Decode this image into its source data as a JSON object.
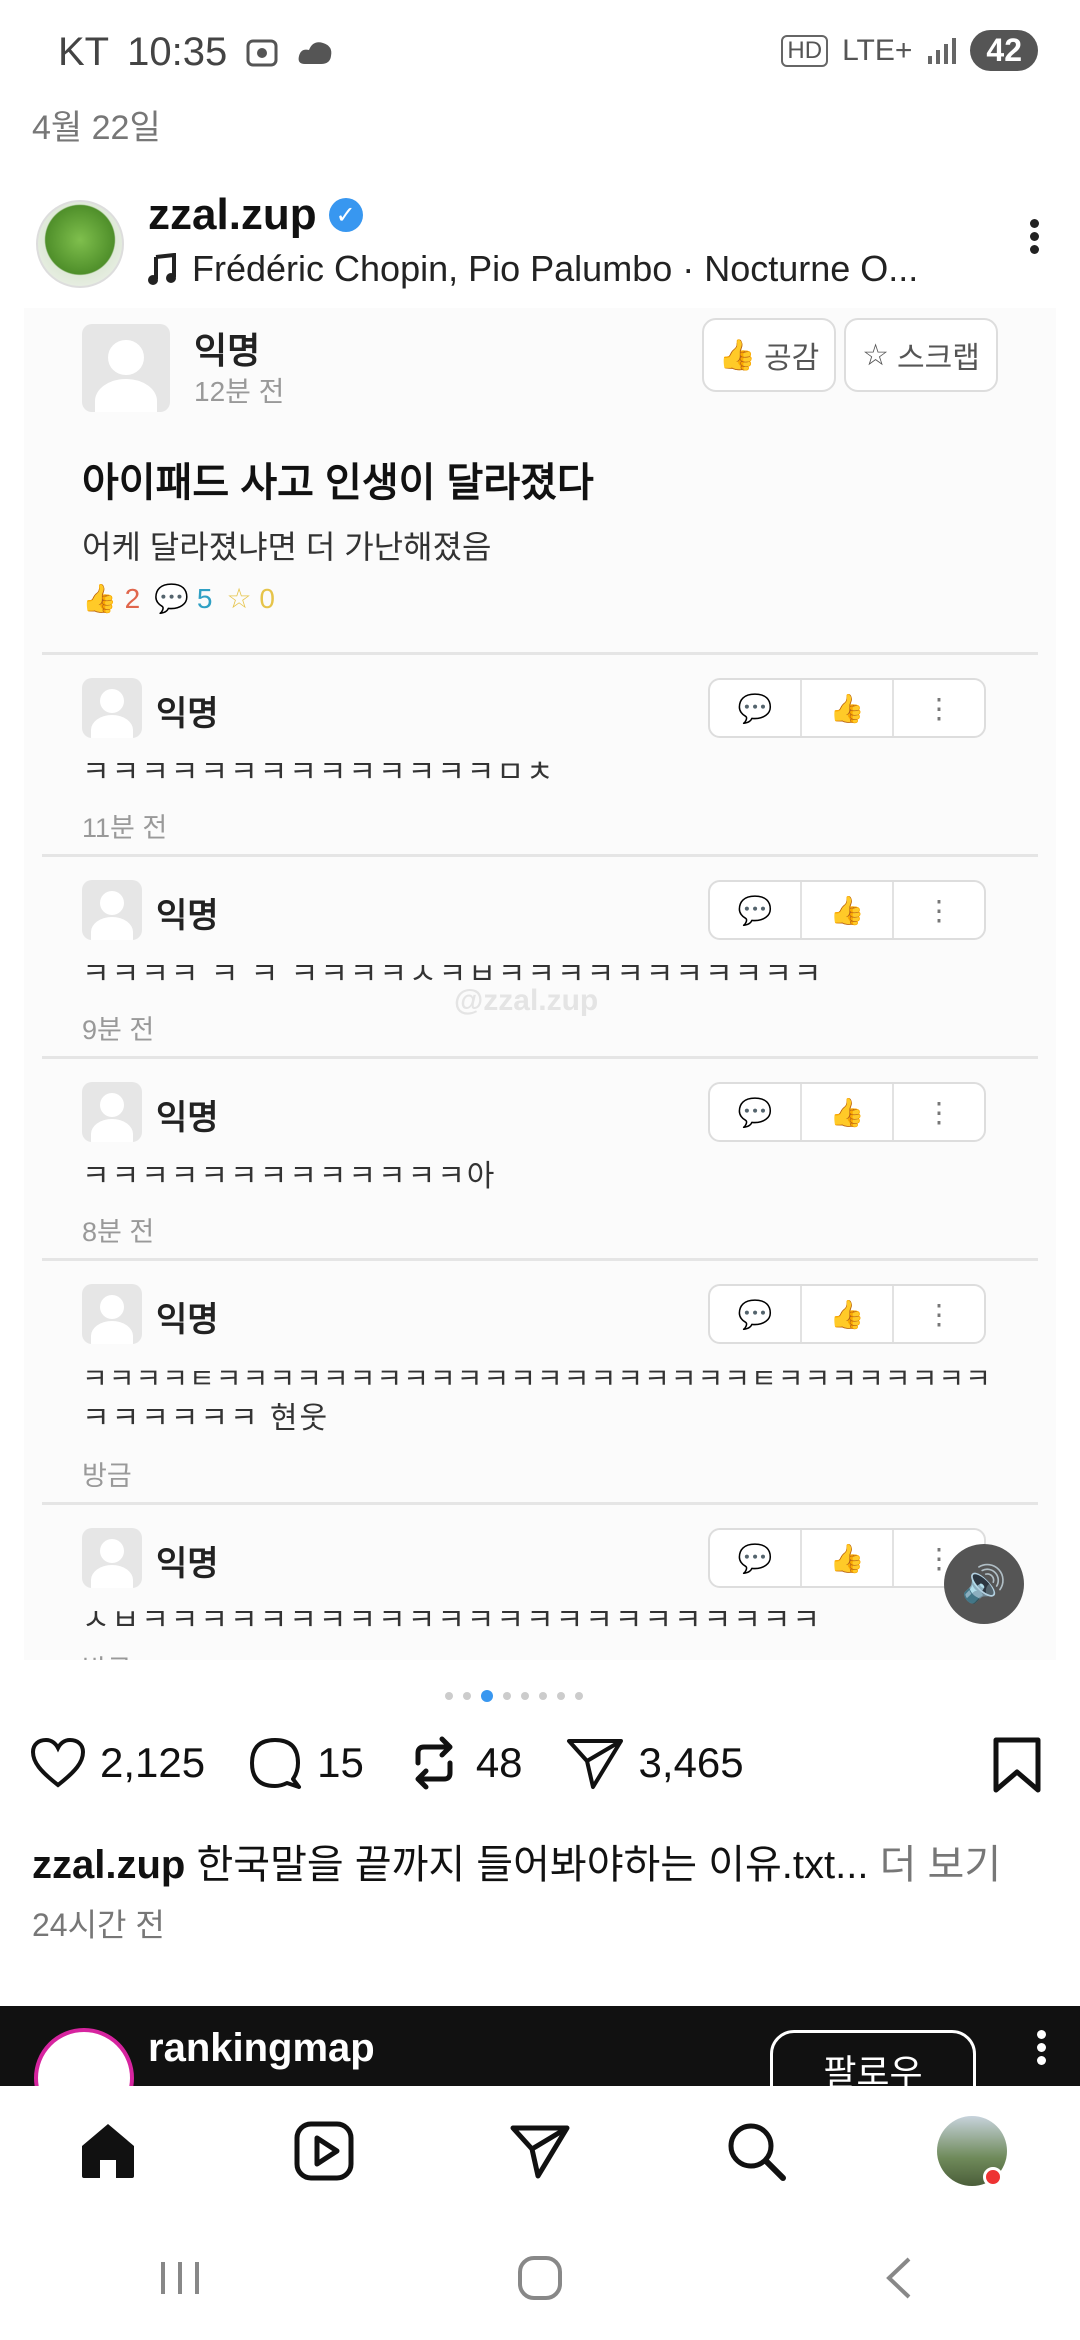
{
  "status_bar": {
    "carrier": "KT",
    "time": "10:35",
    "network": "LTE+",
    "battery": "42"
  },
  "date_header": "4월 22일",
  "post": {
    "username": "zzal.zup",
    "music": "Frédéric Chopin, Pio Palumbo · Nocturne O...",
    "embedded": {
      "author": "익명",
      "author_time": "12분 전",
      "like_btn": "공감",
      "scrap_btn": "스크랩",
      "title": "아이패드 사고 인생이 달라졌다",
      "body": "어케 달라졌냐면 더 가난해졌음",
      "stats": {
        "likes": "2",
        "comments": "5",
        "scraps": "0"
      },
      "watermark": "@zzal.zup",
      "comments": [
        {
          "name": "익명",
          "text": "ㅋㅋㅋㅋㅋㅋㅋㅋㅋㅋㅋㅋㅋㅋㅁㅊ",
          "time": "11분 전"
        },
        {
          "name": "익명",
          "text": "ㅋㅋㅋㅋ ㅋ ㅋ ㅋㅋㅋㅋㅅㅋㅂㅋㅋㅋㅋㅋㅋㅋㅋㅋㅋㅋ",
          "time": "9분 전"
        },
        {
          "name": "익명",
          "text": "ㅋㅋㅋㅋㅋㅋㅋㅋㅋㅋㅋㅋㅋ아",
          "time": "8분 전"
        },
        {
          "name": "익명",
          "text": "ㅋㅋㅋㅋㅌㅋㅋㅋㅋㅋㅋㅋㅋㅋㅋㅋㅋㅋㅋㅋㅋㅋㅋㅋㅋㅌㅋㅋㅋㅋㅋㅋㅋㅋ",
          "text2": "ㅋㅋㅋㅋㅋㅋ 현웃",
          "time": "방금"
        },
        {
          "name": "익명",
          "text": "ㅅㅂㅋㅋㅋㅋㅋㅋㅋㅋㅋㅋㅋㅋㅋㅋㅋㅋㅋㅋㅋㅋㅋㅋㅋ",
          "time": "방금"
        }
      ]
    },
    "carousel": {
      "count": 8,
      "active": 2
    },
    "actions": {
      "likes": "2,125",
      "comments": "15",
      "reposts": "48",
      "shares": "3,465"
    },
    "caption_user": "zzal.zup",
    "caption_text": "한국말을 끝까지 들어봐야하는 이유.txt...",
    "caption_more": "더 보기",
    "time_ago": "24시간 전"
  },
  "next_post": {
    "username": "rankingmap",
    "follow_label": "팔로우"
  },
  "icons": [
    "home-icon",
    "reels-icon",
    "direct-icon",
    "search-icon",
    "profile-icon"
  ]
}
